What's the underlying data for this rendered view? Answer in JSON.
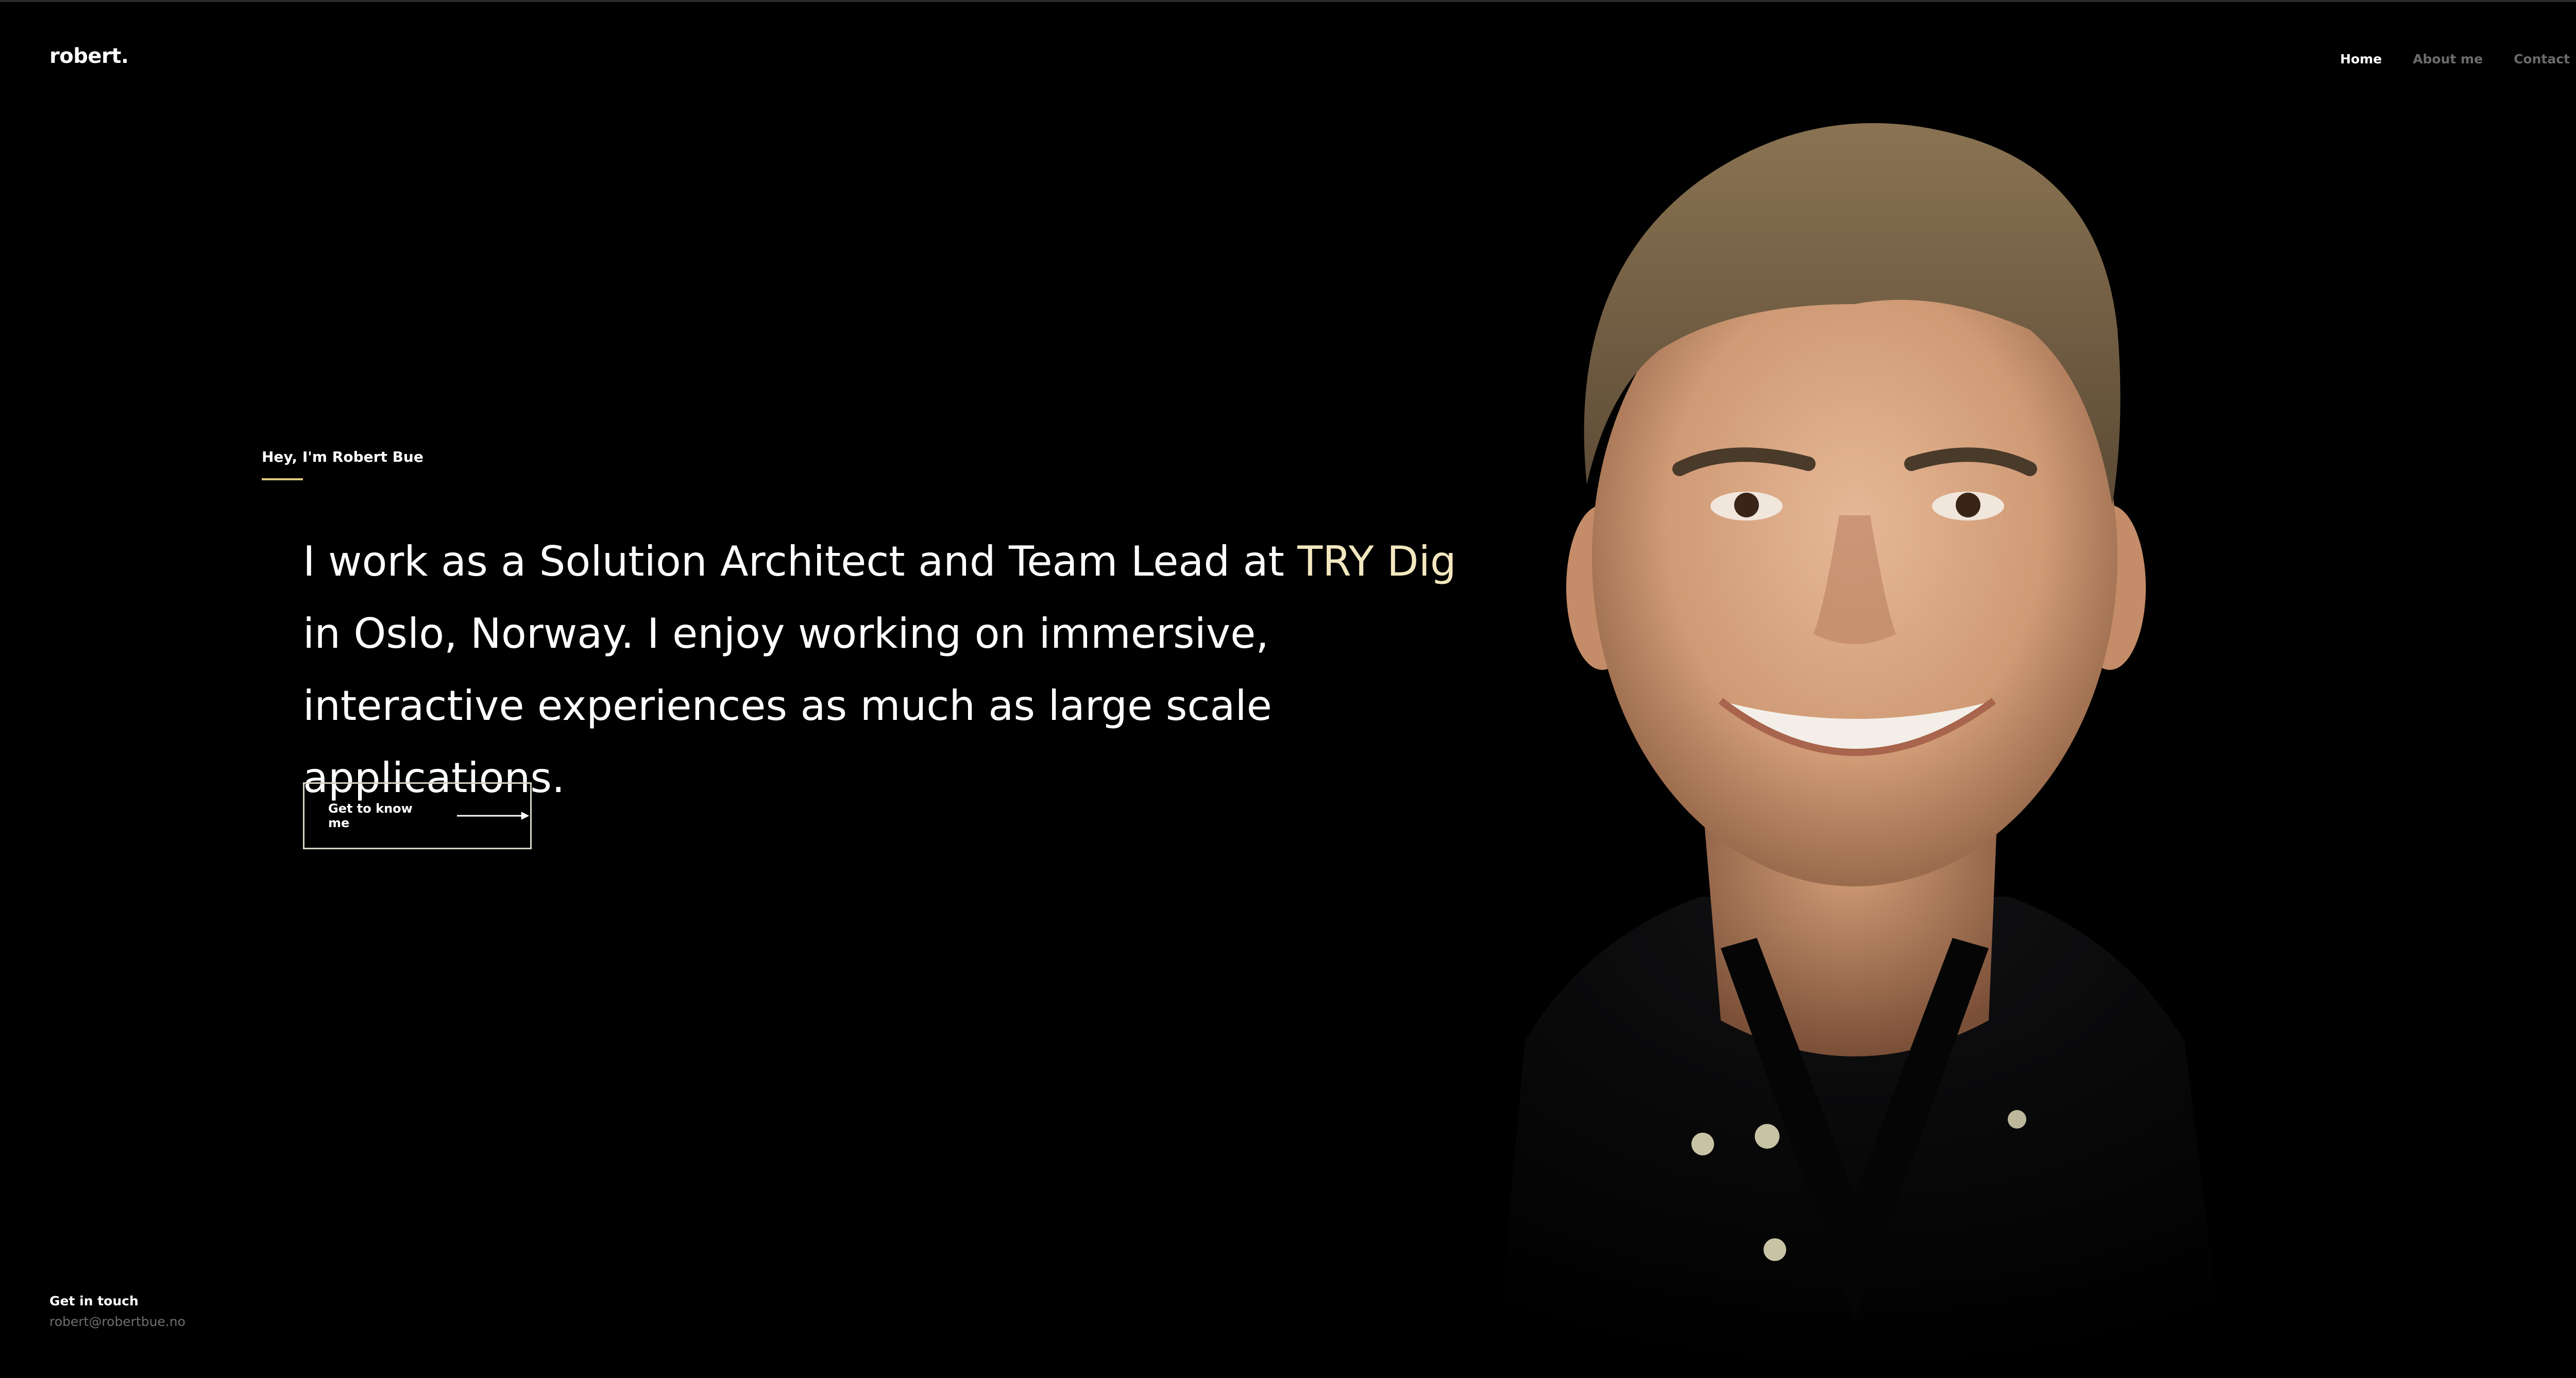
{
  "header": {
    "logo": "robert.",
    "nav": [
      {
        "label": "Home",
        "active": true
      },
      {
        "label": "About me",
        "active": false
      },
      {
        "label": "Contact",
        "active": false
      }
    ]
  },
  "hero": {
    "eyebrow": "Hey, I'm Robert Bue",
    "headline_before": "I work as a Solution Architect and Team Lead at ",
    "headline_accent": "TRY Dig",
    "headline_after": " in Oslo, Norway. I enjoy working on immersive, interactive experiences as much as large scale applications.",
    "cta_label": "Get to know me"
  },
  "footer": {
    "contact_title": "Get in touch",
    "contact_email": "robert@robertbue.no"
  },
  "colors": {
    "background": "#000000",
    "accent": "#f3e7bf",
    "underline": "#e0c97a",
    "muted_text": "#6b6b6b"
  },
  "icons": {
    "cta_icon": "arrow-right-icon"
  }
}
